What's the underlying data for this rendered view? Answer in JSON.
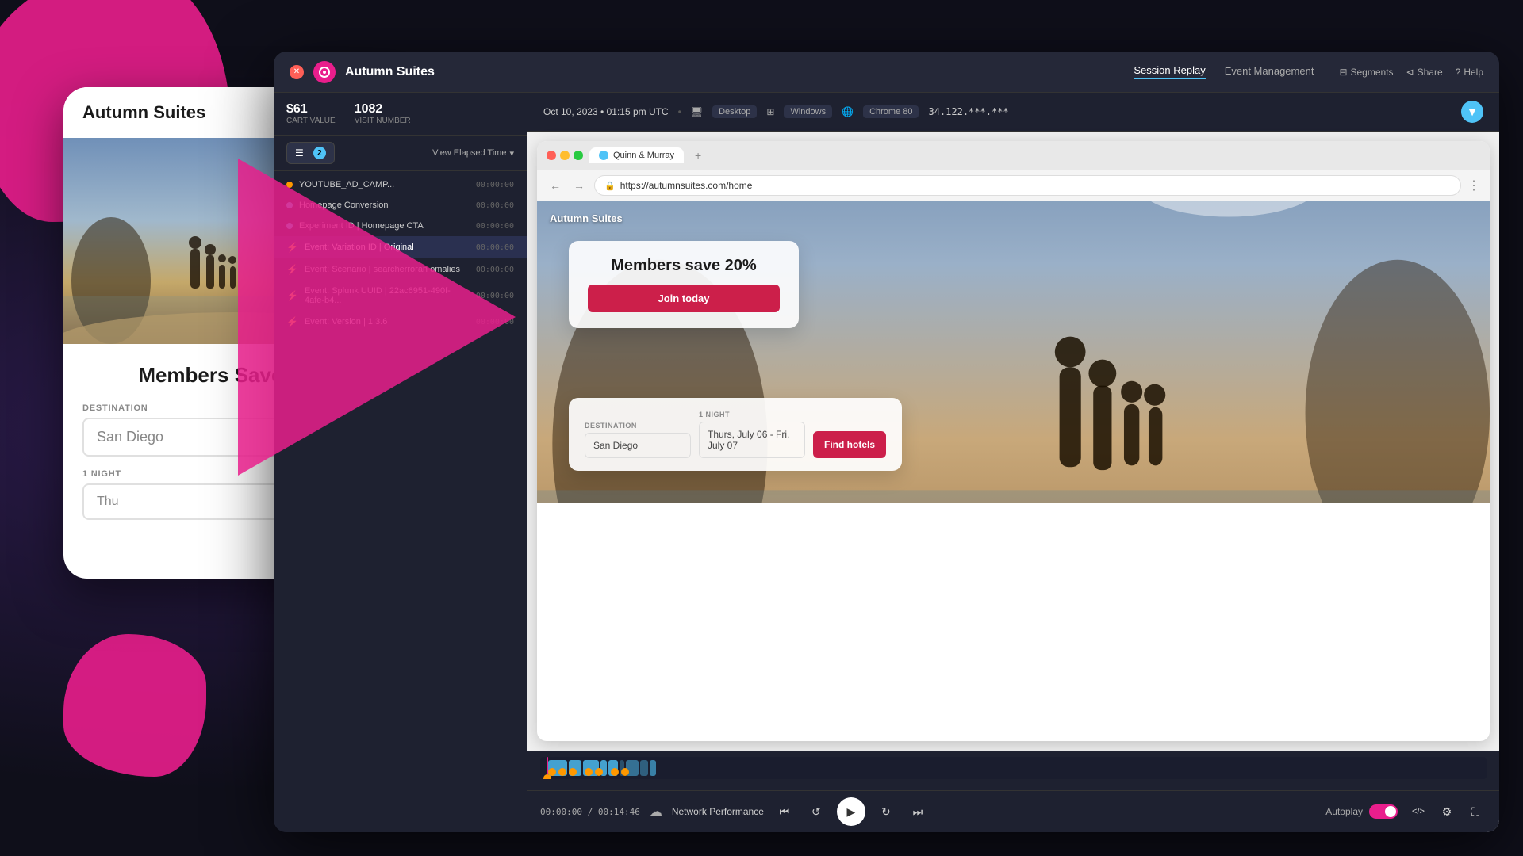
{
  "app": {
    "title": "Autumn Suites",
    "bg_color": "#1a1a2e"
  },
  "session_window": {
    "topbar": {
      "app_name": "Autumn Suites",
      "nav_items": [
        {
          "label": "Session Replay",
          "active": true
        },
        {
          "label": "Event Management",
          "active": false
        }
      ],
      "actions": [
        {
          "label": "Segments",
          "icon": "segments-icon"
        },
        {
          "label": "Share",
          "icon": "share-icon"
        },
        {
          "label": "Help",
          "icon": "help-icon"
        }
      ]
    },
    "info_bar": {
      "date": "Oct 10, 2023 • 01:15 pm UTC",
      "device": "Desktop",
      "os": "Windows",
      "browser": "Chrome 80",
      "ip": "34.122.***.***"
    },
    "browser": {
      "url": "https://autumnsuites.com/home",
      "tab_label": "Quinn & Murray"
    },
    "website": {
      "logo": "Autumn Suites",
      "promo_title": "Members save 20%",
      "join_label": "Join today",
      "destination_label": "DESTINATION",
      "destination_value": "San Diego",
      "nights_label": "1 NIGHT",
      "nights_value": "Thurs, July 06 - Fri, July 07",
      "find_label": "Find hotels"
    },
    "events_panel": {
      "cart_value_label": "Cart value",
      "cart_value": "$61",
      "visit_number_label": "Visit number",
      "visit_number": "1082",
      "filter_btn_label": "Filters",
      "filter_count": "2",
      "elapsed_time_label": "View Elapsed Time",
      "events": [
        {
          "name": "YOUTUBE_AD_CAMP...",
          "time": "00:00:00",
          "type": "orange"
        },
        {
          "name": "Homepage Conversion",
          "time": "00:00:00",
          "type": "blue"
        },
        {
          "name": "Experiment ID | Homepage CTA",
          "time": "00:00:00",
          "type": "blue"
        },
        {
          "name": "Event: Variation ID | Original",
          "time": "00:00:00",
          "type": "orange"
        },
        {
          "name": "Event: Scenario | searcherroran omalies",
          "time": "00:00:00",
          "type": "orange"
        },
        {
          "name": "Event: Splunk UUID | 22ac6951-490f-4afe-b4...",
          "time": "00:00:00",
          "type": "orange"
        },
        {
          "name": "Event: Version | 1.3.6",
          "time": "00:00:00",
          "type": "orange"
        }
      ]
    },
    "playback": {
      "current_time": "00:00:00",
      "total_time": "00:14:46",
      "network_perf_label": "Network Performance",
      "autoplay_label": "Autoplay"
    }
  },
  "mobile_mockup": {
    "logo": "Autumn Suites",
    "promo_title": "Members Save 20%",
    "destination_label": "DESTINATION",
    "destination_value": "San Diego",
    "night_label": "1 NIGHT",
    "night_value": "Thu"
  },
  "icons": {
    "hamburger": "≡",
    "play": "▶",
    "pause": "⏸",
    "skip_back": "⏮",
    "replay": "↺",
    "skip_forward": "⏭",
    "refresh": "↻",
    "back": "←",
    "forward": "→",
    "cloud": "☁",
    "lock": "🔒",
    "code": "</>",
    "settings": "⚙",
    "fullscreen": "⛶",
    "segments": "⊟",
    "share": "⊲",
    "help": "?",
    "chevron_down": "▾",
    "plus": "+"
  }
}
